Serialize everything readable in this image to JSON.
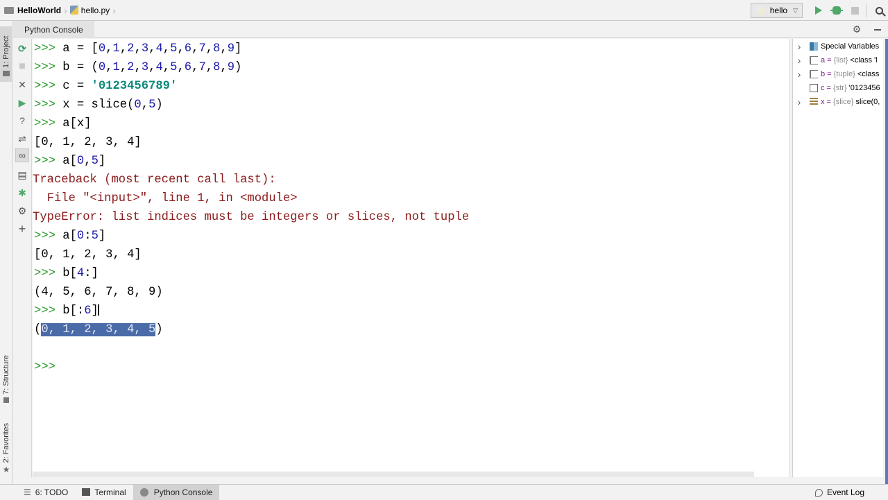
{
  "navbar": {
    "project": "HelloWorld",
    "file": "hello.py",
    "run_config": "hello",
    "icons": [
      "folder-icon",
      "python-file-icon",
      "run-icon",
      "debug-icon",
      "stop-icon",
      "search-icon"
    ]
  },
  "left_strip": {
    "tabs": [
      {
        "label": "1: Project",
        "active": true
      },
      {
        "label": "7: Structure",
        "active": false
      },
      {
        "label": "2: Favorites",
        "active": false
      }
    ]
  },
  "tool_window": {
    "title": "Python Console",
    "icons": [
      "gear-icon",
      "minimize-icon"
    ]
  },
  "console_toolbar": {
    "buttons": [
      {
        "name": "rerun-icon",
        "glyph": "⟳"
      },
      {
        "name": "stop-icon",
        "glyph": "■"
      },
      {
        "name": "close-icon",
        "glyph": "✕"
      },
      {
        "name": "execute-icon",
        "glyph": "▶"
      },
      {
        "name": "help-icon",
        "glyph": "?"
      },
      {
        "name": "soft-wrap-icon",
        "glyph": "⇌"
      },
      {
        "name": "show-variables-icon",
        "glyph": "∞"
      },
      {
        "name": "history-icon",
        "glyph": "▤"
      },
      {
        "name": "attach-debugger-icon",
        "glyph": "✱"
      },
      {
        "name": "settings-icon",
        "glyph": "⚙"
      },
      {
        "name": "new-console-icon",
        "glyph": "+"
      }
    ]
  },
  "console": {
    "prompt": ">>>",
    "lines": [
      {
        "type": "input",
        "segments": [
          {
            "t": "a = [",
            "c": ""
          },
          {
            "t": "0",
            "c": "num"
          },
          {
            "t": ",",
            "c": ""
          },
          {
            "t": "1",
            "c": "num"
          },
          {
            "t": ",",
            "c": ""
          },
          {
            "t": "2",
            "c": "num"
          },
          {
            "t": ",",
            "c": ""
          },
          {
            "t": "3",
            "c": "num"
          },
          {
            "t": ",",
            "c": ""
          },
          {
            "t": "4",
            "c": "num"
          },
          {
            "t": ",",
            "c": ""
          },
          {
            "t": "5",
            "c": "num"
          },
          {
            "t": ",",
            "c": ""
          },
          {
            "t": "6",
            "c": "num"
          },
          {
            "t": ",",
            "c": ""
          },
          {
            "t": "7",
            "c": "num"
          },
          {
            "t": ",",
            "c": ""
          },
          {
            "t": "8",
            "c": "num"
          },
          {
            "t": ",",
            "c": ""
          },
          {
            "t": "9",
            "c": "num"
          },
          {
            "t": "]",
            "c": ""
          }
        ]
      },
      {
        "type": "input",
        "segments": [
          {
            "t": "b = (",
            "c": ""
          },
          {
            "t": "0",
            "c": "num"
          },
          {
            "t": ",",
            "c": ""
          },
          {
            "t": "1",
            "c": "num"
          },
          {
            "t": ",",
            "c": ""
          },
          {
            "t": "2",
            "c": "num"
          },
          {
            "t": ",",
            "c": ""
          },
          {
            "t": "3",
            "c": "num"
          },
          {
            "t": ",",
            "c": ""
          },
          {
            "t": "4",
            "c": "num"
          },
          {
            "t": ",",
            "c": ""
          },
          {
            "t": "5",
            "c": "num"
          },
          {
            "t": ",",
            "c": ""
          },
          {
            "t": "6",
            "c": "num"
          },
          {
            "t": ",",
            "c": ""
          },
          {
            "t": "7",
            "c": "num"
          },
          {
            "t": ",",
            "c": ""
          },
          {
            "t": "8",
            "c": "num"
          },
          {
            "t": ",",
            "c": ""
          },
          {
            "t": "9",
            "c": "num"
          },
          {
            "t": ")",
            "c": ""
          }
        ]
      },
      {
        "type": "input",
        "segments": [
          {
            "t": "c = ",
            "c": ""
          },
          {
            "t": "'0123456789'",
            "c": "str"
          }
        ]
      },
      {
        "type": "input",
        "segments": [
          {
            "t": "x = slice(",
            "c": ""
          },
          {
            "t": "0",
            "c": "num"
          },
          {
            "t": ",",
            "c": ""
          },
          {
            "t": "5",
            "c": "num"
          },
          {
            "t": ")",
            "c": ""
          }
        ]
      },
      {
        "type": "input",
        "segments": [
          {
            "t": "a[x]",
            "c": ""
          }
        ]
      },
      {
        "type": "output",
        "segments": [
          {
            "t": "[0, 1, 2, 3, 4]",
            "c": ""
          }
        ]
      },
      {
        "type": "input",
        "segments": [
          {
            "t": "a[",
            "c": ""
          },
          {
            "t": "0",
            "c": "num"
          },
          {
            "t": ",",
            "c": ""
          },
          {
            "t": "5",
            "c": "num"
          },
          {
            "t": "]",
            "c": ""
          }
        ]
      },
      {
        "type": "error",
        "segments": [
          {
            "t": "Traceback (most recent call last):",
            "c": "err"
          }
        ]
      },
      {
        "type": "error",
        "segments": [
          {
            "t": "  File \"<input>\", line 1, in <module>",
            "c": "err"
          }
        ]
      },
      {
        "type": "error",
        "segments": [
          {
            "t": "TypeError: list indices must be integers or slices, not tuple",
            "c": "err"
          }
        ]
      },
      {
        "type": "input",
        "segments": [
          {
            "t": "a[",
            "c": ""
          },
          {
            "t": "0",
            "c": "num"
          },
          {
            "t": ":",
            "c": ""
          },
          {
            "t": "5",
            "c": "num"
          },
          {
            "t": "]",
            "c": ""
          }
        ]
      },
      {
        "type": "output",
        "segments": [
          {
            "t": "[0, 1, 2, 3, 4]",
            "c": ""
          }
        ]
      },
      {
        "type": "input",
        "segments": [
          {
            "t": "b[",
            "c": ""
          },
          {
            "t": "4",
            "c": "num"
          },
          {
            "t": ":]",
            "c": ""
          }
        ]
      },
      {
        "type": "output",
        "segments": [
          {
            "t": "(4, 5, 6, 7, 8, 9)",
            "c": ""
          }
        ]
      },
      {
        "type": "input",
        "segments": [
          {
            "t": "b[:",
            "c": ""
          },
          {
            "t": "6",
            "c": "num"
          },
          {
            "t": "]",
            "c": ""
          }
        ],
        "cursor": true
      },
      {
        "type": "output",
        "segments": [
          {
            "t": "(",
            "c": ""
          },
          {
            "t": "0, 1, 2, 3, 4, 5",
            "c": "sel"
          },
          {
            "t": ")",
            "c": ""
          }
        ]
      },
      {
        "type": "blank",
        "segments": []
      },
      {
        "type": "input",
        "segments": []
      }
    ]
  },
  "variables": {
    "rows": [
      {
        "icon": "special",
        "name": "Special Variables",
        "type": "",
        "value": "",
        "expandable": true
      },
      {
        "icon": "list",
        "name": "a",
        "type": "{list}",
        "value": "<class 'l",
        "expandable": true
      },
      {
        "icon": "list",
        "name": "b",
        "type": "{tuple}",
        "value": "<class",
        "expandable": true
      },
      {
        "icon": "str",
        "name": "c",
        "type": "{str}",
        "value": "'0123456",
        "expandable": false
      },
      {
        "icon": "slice",
        "name": "x",
        "type": "{slice}",
        "value": "slice(0,",
        "expandable": true
      }
    ]
  },
  "status_bar": {
    "tabs": [
      {
        "label": "6: TODO",
        "active": false
      },
      {
        "label": "Terminal",
        "active": false
      },
      {
        "label": "Python Console",
        "active": true
      }
    ],
    "event_log": "Event Log"
  },
  "colors": {
    "prompt": "#2a9a2a",
    "number": "#1a18a8",
    "string": "#0a8a7a",
    "error": "#8b1a1a",
    "selection": "#4a6aa8",
    "run_green": "#4fa869"
  }
}
